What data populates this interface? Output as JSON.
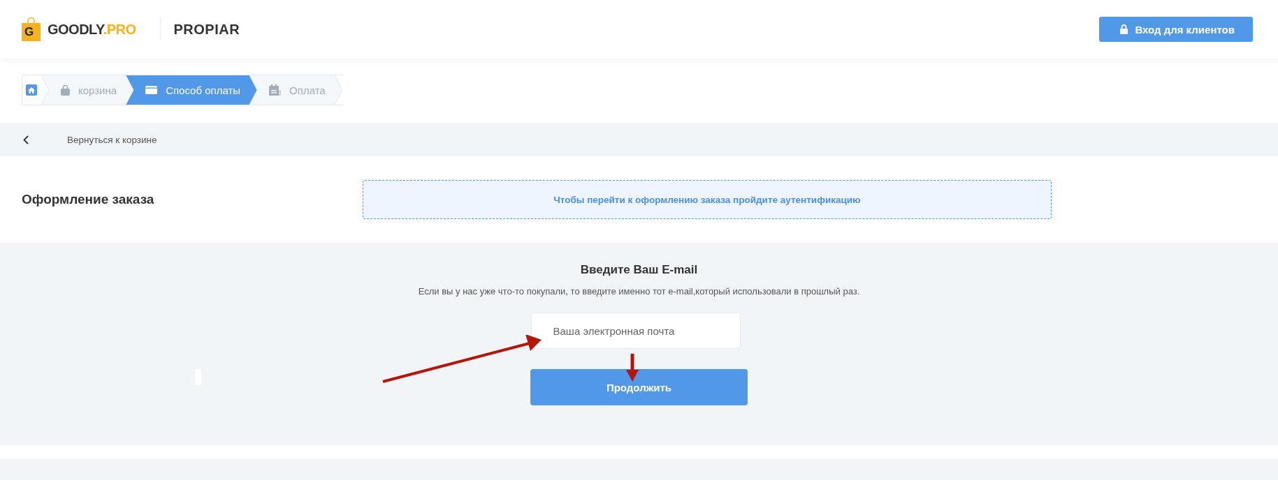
{
  "header": {
    "logo": {
      "name": "GOODLY",
      "suffix": ".PRO",
      "badge": "G"
    },
    "shop_name": "PROPIAR",
    "login_button": "Вход для клиентов"
  },
  "breadcrumb": [
    {
      "kind": "home",
      "selected": false
    },
    {
      "kind": "step",
      "label": "корзина",
      "selected": false
    },
    {
      "kind": "step",
      "label": "Способ оплаты",
      "selected": true
    },
    {
      "kind": "step",
      "label": "Оплата",
      "selected": false
    }
  ],
  "back_link": "Вернуться к корзине",
  "page_title": "Оформление заказа",
  "notice": "Чтобы перейти к оформлению заказа пройдите аутентификацию",
  "email_form": {
    "title": "Введите Ваш E-mail",
    "hint": "Если вы у нас уже что-то покупали, то введите именно тот e-mail,который использовали в прошлый раз.",
    "email_field": {
      "placeholder": "Ваша электронная почта"
    },
    "submit_button": "Продолжить"
  }
}
